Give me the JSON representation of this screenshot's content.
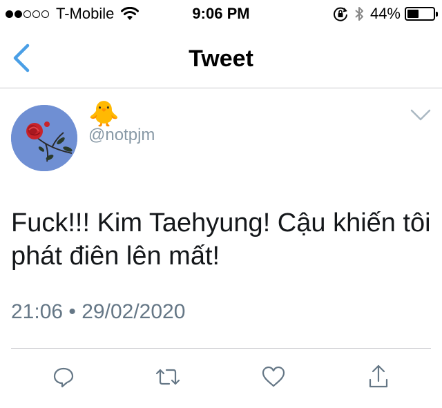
{
  "status_bar": {
    "carrier": "T-Mobile",
    "time": "9:06 PM",
    "battery_percent_label": "44%",
    "battery_level": 0.44,
    "signal_bars_filled": 2,
    "signal_bars_total": 5,
    "icons": [
      "signal-dots-icon",
      "wifi-icon",
      "rotation-lock-icon",
      "bluetooth-icon",
      "battery-icon"
    ]
  },
  "nav": {
    "title": "Tweet",
    "back_icon": "chevron-left-icon",
    "accent_color": "#4a9fe6"
  },
  "tweet": {
    "display_name": "🐥",
    "handle": "@notpjm",
    "avatar": "rose-on-blue-avatar",
    "menu_icon": "chevron-down-icon",
    "text": "Fuck!!! Kim Taehyung! Cậu khiến tôi phát điên lên mất!",
    "timestamp": "21:06 • 29/02/2020"
  },
  "actions": [
    {
      "name": "reply",
      "icon": "reply-icon"
    },
    {
      "name": "retweet",
      "icon": "retweet-icon"
    },
    {
      "name": "like",
      "icon": "heart-icon"
    },
    {
      "name": "share",
      "icon": "share-icon"
    }
  ],
  "colors": {
    "text_primary": "#14171a",
    "text_secondary": "#657786",
    "handle": "#8899a6",
    "divider": "#c8c8cc",
    "avatar_bg": "#6f8fd3"
  }
}
